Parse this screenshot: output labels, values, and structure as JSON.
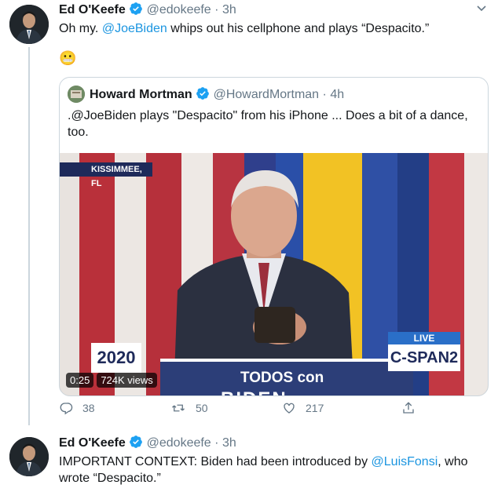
{
  "tweet1": {
    "name": "Ed O'Keefe",
    "handle": "@edokeefe",
    "sep": "·",
    "time": "3h",
    "text_prefix": "Oh my.",
    "mention": "@JoeBiden",
    "text_suffix": "whips out his cellphone and plays “Despacito.”",
    "emoji": "😬"
  },
  "quote": {
    "name": "Howard Mortman",
    "handle": "@HowardMortman",
    "sep": "·",
    "time": "4h",
    "text": ".@JoeBiden plays \"Despacito\" from his iPhone ... Does a bit of a dance, too.",
    "video": {
      "location": "KISSIMMEE, FL",
      "live_label": "LIVE",
      "channel": "C-SPAN2",
      "logo_top": "2020",
      "podium_text": "TODOS con",
      "podium_text2": "BIDEN",
      "duration": "0:25",
      "views": "724K views"
    }
  },
  "actions": {
    "replies": "38",
    "retweets": "50",
    "likes": "217"
  },
  "tweet2": {
    "name": "Ed O'Keefe",
    "handle": "@edokeefe",
    "sep": "·",
    "time": "3h",
    "text_prefix": "IMPORTANT CONTEXT: Biden had been introduced by",
    "mention": "@LuisFonsi",
    "text_suffix": ", who wrote “Despacito.”"
  },
  "colors": {
    "link": "#1b95e0",
    "verified": "#1da1f2",
    "secondary": "#657786",
    "border": "#ccd6dd"
  }
}
